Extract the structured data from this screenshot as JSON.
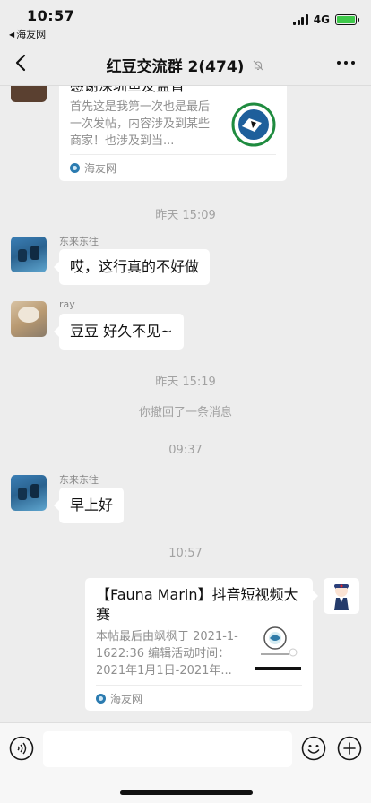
{
  "status_bar": {
    "time": "10:57",
    "back_app": "海友网",
    "network": "4G"
  },
  "nav": {
    "title": "红豆交流群 2(474)"
  },
  "messages": {
    "top_card": {
      "title": "感谢深圳鱼友监督",
      "desc": "首先这是我第一次也是最后一次发帖，内容涉及到某些商家！也涉及到当...",
      "source": "海友网"
    },
    "time1": "昨天 15:09",
    "msg1": {
      "sender": "东来东往",
      "text": "哎，这行真的不好做"
    },
    "msg2": {
      "sender": "ray",
      "text": "豆豆 好久不见~"
    },
    "time2": "昨天 15:19",
    "recall": "你撤回了一条消息",
    "time3": "09:37",
    "msg3": {
      "sender": "东来东往",
      "text": "早上好"
    },
    "time4": "10:57",
    "my_card": {
      "title": "【Fauna Marin】抖音短视频大赛",
      "desc": "本帖最后由飒枫于 2021-1-1622:36 编辑活动时间：2021年1月1日-2021年...",
      "source": "海友网"
    }
  },
  "colors": {
    "background": "#ededed",
    "bubble": "#ffffff",
    "source_icon": "#2b7bb0"
  }
}
